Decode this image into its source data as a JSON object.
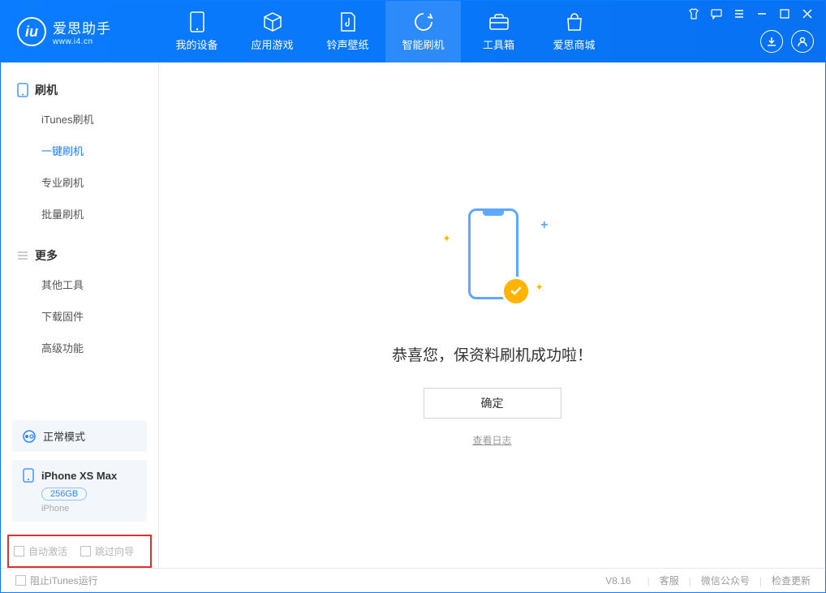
{
  "brand": {
    "name": "爱思助手",
    "url": "www.i4.cn"
  },
  "nav": {
    "items": [
      {
        "label": "我的设备"
      },
      {
        "label": "应用游戏"
      },
      {
        "label": "铃声壁纸"
      },
      {
        "label": "智能刷机"
      },
      {
        "label": "工具箱"
      },
      {
        "label": "爱思商城"
      }
    ]
  },
  "sidebar": {
    "group1": {
      "title": "刷机",
      "items": [
        "iTunes刷机",
        "一键刷机",
        "专业刷机",
        "批量刷机"
      ]
    },
    "group2": {
      "title": "更多",
      "items": [
        "其他工具",
        "下载固件",
        "高级功能"
      ]
    },
    "mode": "正常模式",
    "device": {
      "name": "iPhone XS Max",
      "capacity": "256GB",
      "type": "iPhone"
    },
    "checkbox1": "自动激活",
    "checkbox2": "跳过向导"
  },
  "main": {
    "success": "恭喜您，保资料刷机成功啦！",
    "ok": "确定",
    "view_log": "查看日志"
  },
  "footer": {
    "block_itunes": "阻止iTunes运行",
    "version": "V8.16",
    "links": [
      "客服",
      "微信公众号",
      "检查更新"
    ]
  }
}
